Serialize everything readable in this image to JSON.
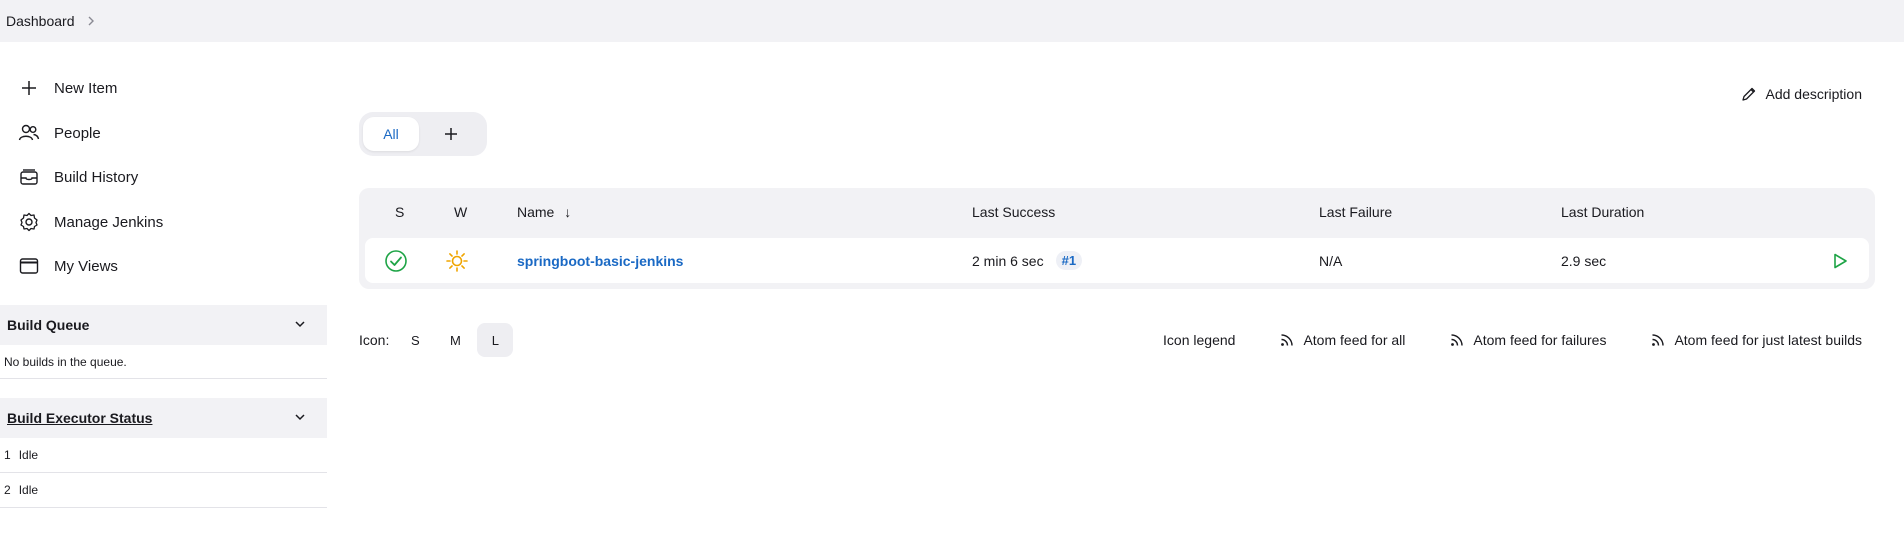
{
  "breadcrumb": {
    "items": [
      {
        "label": "Dashboard"
      }
    ]
  },
  "sidebar": {
    "tasks": [
      {
        "label": "New Item",
        "icon": "plus-icon"
      },
      {
        "label": "People",
        "icon": "people-icon"
      },
      {
        "label": "Build History",
        "icon": "build-history-icon"
      },
      {
        "label": "Manage Jenkins",
        "icon": "gear-icon"
      },
      {
        "label": "My Views",
        "icon": "window-icon"
      }
    ]
  },
  "build_queue": {
    "title": "Build Queue",
    "empty_text": "No builds in the queue."
  },
  "executors": {
    "title": "Build Executor Status",
    "items": [
      {
        "number": "1",
        "status": "Idle"
      },
      {
        "number": "2",
        "status": "Idle"
      }
    ]
  },
  "main": {
    "add_description": "Add description",
    "tabs": [
      {
        "label": "All",
        "active": true
      }
    ],
    "table": {
      "columns": {
        "s": "S",
        "w": "W",
        "name": "Name",
        "name_sort": "↓",
        "last_success": "Last Success",
        "last_failure": "Last Failure",
        "last_duration": "Last Duration"
      },
      "rows": [
        {
          "status_icon": "success-check-icon",
          "weather_icon": "sunny-icon",
          "name": "springboot-basic-jenkins",
          "last_success": "2 min 6 sec",
          "last_success_build": "#1",
          "last_failure": "N/A",
          "last_duration": "2.9 sec"
        }
      ]
    },
    "icon_size": {
      "label": "Icon:",
      "options": [
        "S",
        "M",
        "L"
      ],
      "selected": "L"
    },
    "footer_links": {
      "legend": "Icon legend",
      "atom_all": "Atom feed for all",
      "atom_failures": "Atom feed for failures",
      "atom_latest": "Atom feed for just latest builds"
    }
  },
  "colors": {
    "accent": "#1a69c4",
    "success": "#1ea446",
    "weather": "#f0a500",
    "panel": "#f2f2f5"
  }
}
